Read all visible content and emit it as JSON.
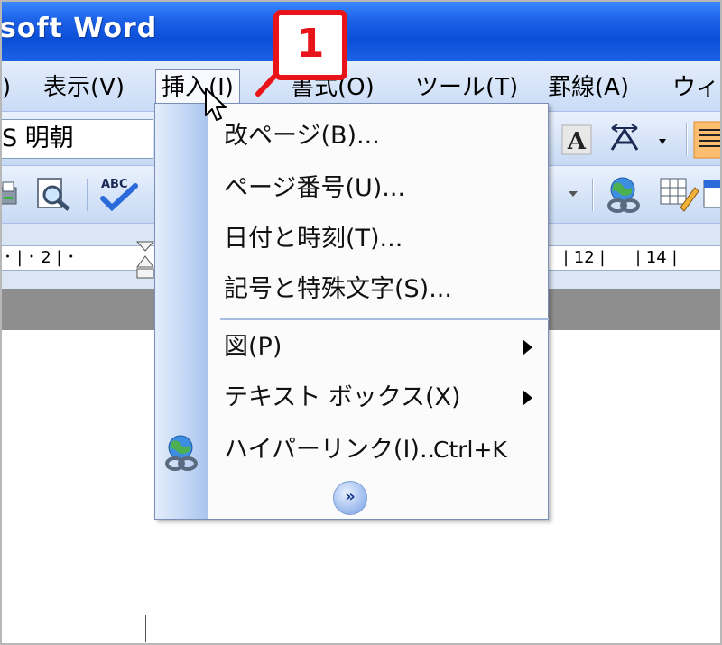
{
  "window": {
    "title": "soft Word"
  },
  "menubar": {
    "items": [
      {
        "label": ")"
      },
      {
        "label": "表示(V)"
      },
      {
        "label": "挿入(I)"
      },
      {
        "label": "書式(O)"
      },
      {
        "label": "ツール(T)"
      },
      {
        "label": "罫線(A)"
      },
      {
        "label": "ウィン"
      }
    ]
  },
  "toolbar": {
    "font_name": "S 明朝"
  },
  "ruler": {
    "labels": [
      "･ | ･ 2 | ･",
      "| 12 |",
      "| 14 |"
    ]
  },
  "insert_menu": {
    "items": [
      {
        "label": "改ページ(B)..."
      },
      {
        "label": "ページ番号(U)..."
      },
      {
        "label": "日付と時刻(T)..."
      },
      {
        "label": "記号と特殊文字(S)..."
      },
      {
        "label": "図(P)",
        "submenu": true
      },
      {
        "label": "テキスト ボックス(X)",
        "submenu": true
      },
      {
        "label": "ハイパーリンク(I)...",
        "shortcut": "Ctrl+K"
      }
    ],
    "expand_glyph": "»"
  },
  "annotation": {
    "step_number": "1"
  },
  "colors": {
    "callout_red": "#e8141a",
    "titlebar_blue": "#0b4fd6"
  }
}
